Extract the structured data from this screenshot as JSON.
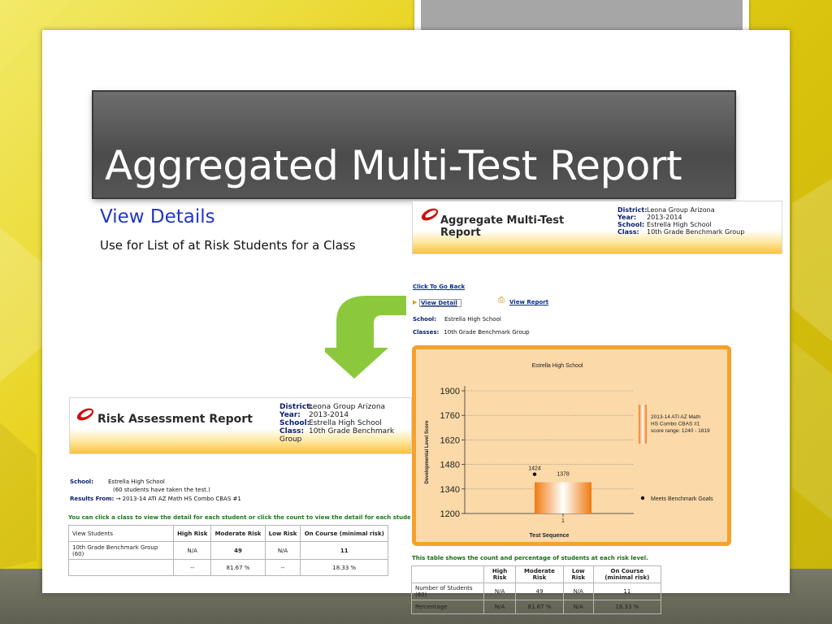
{
  "slide": {
    "title": "Aggregated Multi-Test Report",
    "subtitle": "View Details",
    "description": "Use for List of at Risk Students for a Class"
  },
  "aggregate_report": {
    "title_line1": "Aggregate Multi-Test",
    "title_line2": "Report",
    "meta": [
      {
        "label": "District:",
        "value": "Leona Group Arizona"
      },
      {
        "label": "Year:",
        "value": "2013-2014"
      },
      {
        "label": "School:",
        "value": "Estrella High School"
      },
      {
        "label": "Class:",
        "value": "10th Grade Benchmark Group"
      }
    ],
    "back_link": "Click To Go Back",
    "view_detail": "View Detail",
    "view_report": "View Report",
    "school_label": "School:",
    "school_value": "Estrella High School",
    "classes_label": "Classes:",
    "classes_value": "10th Grade Benchmark Group",
    "table_note": "This table shows the count and percentage of students at each risk level.",
    "table": {
      "headers": [
        "",
        "High Risk",
        "Moderate Risk",
        "Low Risk",
        "On Course (minimal risk)"
      ],
      "rows": [
        [
          "Number of Students (60)",
          "N/A",
          "49",
          "N/A",
          "11"
        ],
        [
          "Percentage",
          "N/A",
          "81.67 %",
          "N/A",
          "18.33 %"
        ]
      ]
    }
  },
  "risk_report": {
    "title": "Risk Assessment Report",
    "meta": [
      {
        "label": "District:",
        "value": "Leona Group Arizona"
      },
      {
        "label": "Year:",
        "value": "2013-2014"
      },
      {
        "label": "School:",
        "value": "Estrella High School"
      },
      {
        "label": "Class:",
        "value": "10th Grade Benchmark Group"
      }
    ],
    "school_label": "School:",
    "school_value": "Estrella High School",
    "students_note": "(60 students have taken the test.)",
    "results_label": "Results From:",
    "results_value": "→ 2013-14 ATI AZ Math HS Combo CBAS #1",
    "click_note": "You can click a class to view the detail for each student or click the count to view the detail for each student at the",
    "table": {
      "headers": [
        "View Students",
        "High Risk",
        "Moderate Risk",
        "Low Risk",
        "On Course (minimal risk)"
      ],
      "rows": [
        [
          "10th Grade Benchmark Group (60)",
          "N/A",
          "49",
          "N/A",
          "11"
        ],
        [
          "",
          "--",
          "81.67 %",
          "--",
          "18.33 %"
        ]
      ]
    }
  },
  "chart_data": {
    "type": "bar",
    "title": "Estrella High School",
    "xlabel": "Test Sequence",
    "ylabel": "Developmental Level Score",
    "categories": [
      "1"
    ],
    "ylim": [
      1200,
      1900
    ],
    "yticks": [
      1200,
      1340,
      1480,
      1620,
      1760,
      1900
    ],
    "series": [
      {
        "name": "2013-14 ATI AZ Math HS Combo CBAS #1 score range: 1240 - 1819",
        "range": [
          1240,
          1819
        ],
        "values": [
          1378
        ],
        "labels": [
          "1378"
        ]
      }
    ],
    "benchmark": {
      "name": "Meets Benchmark Goals",
      "values": [
        1424
      ],
      "labels": [
        "1424"
      ]
    },
    "legend": "right",
    "grid": true
  }
}
